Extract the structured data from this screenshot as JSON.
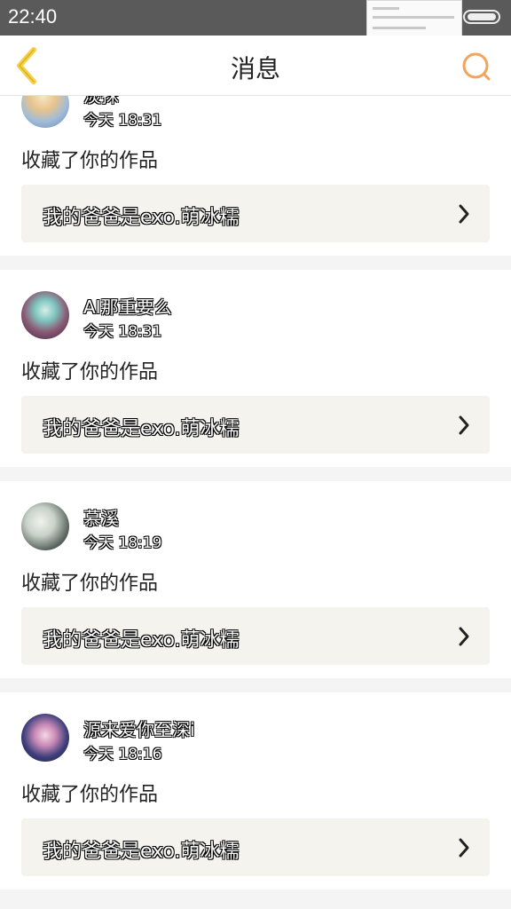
{
  "status_bar": {
    "time": "22:40",
    "battery": "battery-icon"
  },
  "header": {
    "title": "消息",
    "back_icon": "chevron-left-icon",
    "search_icon": "search-icon"
  },
  "accent_color": "#f2a35c",
  "back_color": "#f7d043",
  "messages": [
    {
      "user": "淡抹",
      "time": "今天 18:31",
      "action": "收藏了你的作品",
      "work": "我的爸爸是exo.萌冰糯"
    },
    {
      "user": "AI那重要么",
      "time": "今天 18:31",
      "action": "收藏了你的作品",
      "work": "我的爸爸是exo.萌冰糯"
    },
    {
      "user": "慕溪",
      "time": "今天 18:19",
      "action": "收藏了你的作品",
      "work": "我的爸爸是exo.萌冰糯"
    },
    {
      "user": "源来爱你至深i",
      "time": "今天 18:16",
      "action": "收藏了你的作品",
      "work": "我的爸爸是exo.萌冰糯"
    }
  ]
}
